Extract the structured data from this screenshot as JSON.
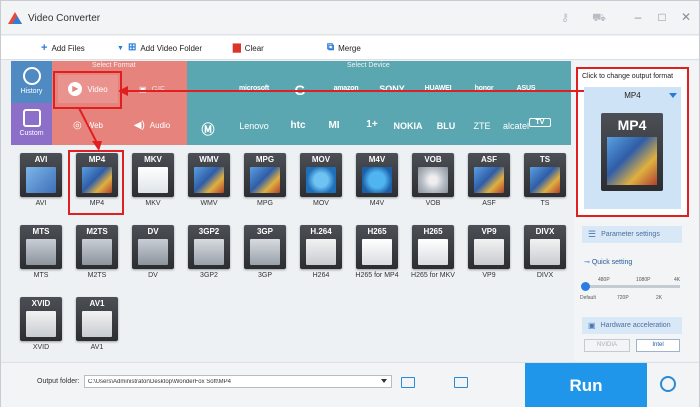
{
  "window": {
    "title": "Video Converter",
    "icons": [
      "key-icon",
      "cart-icon",
      "minimize-icon",
      "maximize-icon",
      "close-icon"
    ]
  },
  "toolbar": {
    "add_files": "Add Files",
    "add_video_folder": "Add Video Folder",
    "clear": "Clear",
    "merge": "Merge"
  },
  "format_panel": {
    "select_format_label": "Select Format",
    "select_device_label": "Select Device",
    "history": "History",
    "custom": "Custom",
    "video": "Video",
    "web": "Web",
    "audio": "Audio",
    "gif_tab": "GIF",
    "device_brands_row1": [
      "apple-icon",
      "microsoft",
      "google",
      "amazon",
      "SONY",
      "HUAWEI",
      "honor",
      "ASUS"
    ],
    "device_brands_row2": [
      "motorola-icon",
      "Lenovo",
      "htc",
      "MI",
      "1+",
      "NOKIA",
      "BLU",
      "ZTE",
      "alcatel",
      "TV"
    ]
  },
  "formats": [
    {
      "tag": "AVI",
      "label": "AVI",
      "art": "reel"
    },
    {
      "tag": "MP4",
      "label": "MP4",
      "art": "film"
    },
    {
      "tag": "MKV",
      "label": "MKV",
      "art": "matroska"
    },
    {
      "tag": "WMV",
      "label": "WMV",
      "art": "film"
    },
    {
      "tag": "MPG",
      "label": "MPG",
      "art": "film"
    },
    {
      "tag": "MOV",
      "label": "MOV",
      "art": "quicktime"
    },
    {
      "tag": "M4V",
      "label": "M4V",
      "art": "itunes"
    },
    {
      "tag": "VOB",
      "label": "VOB",
      "art": "disc"
    },
    {
      "tag": "ASF",
      "label": "ASF",
      "art": "film"
    },
    {
      "tag": "TS",
      "label": "TS",
      "art": "film"
    },
    {
      "tag": "MTS",
      "label": "MTS",
      "art": "camera"
    },
    {
      "tag": "M2TS",
      "label": "M2TS",
      "art": "camera"
    },
    {
      "tag": "DV",
      "label": "DV",
      "art": "camera"
    },
    {
      "tag": "3GP2",
      "label": "3GP2",
      "art": "phone"
    },
    {
      "tag": "3GP",
      "label": "3GP",
      "art": "phone"
    },
    {
      "tag": "H.264",
      "label": "H264",
      "art": "encoder"
    },
    {
      "tag": "H265",
      "label": "H265 for MP4",
      "art": "hevc"
    },
    {
      "tag": "H265",
      "label": "H265 for MKV",
      "art": "hevc"
    },
    {
      "tag": "VP9",
      "label": "VP9",
      "art": "encoder"
    },
    {
      "tag": "DIVX",
      "label": "DIVX",
      "art": "encoder"
    },
    {
      "tag": "XVID",
      "label": "XVID",
      "art": "encoder"
    },
    {
      "tag": "AV1",
      "label": "AV1",
      "art": "encoder"
    }
  ],
  "output": {
    "hint": "Click to change output format",
    "selected": "MP4",
    "parameter_settings": "Parameter settings",
    "quick_setting": "Quick setting",
    "tick_top": [
      "480P",
      "1080P",
      "4K"
    ],
    "tick_bottom": [
      "Default",
      "720P",
      "2K"
    ],
    "quality_position": 0.0,
    "hardware_acceleration": "Hardware acceleration",
    "nvidia": "NVIDIA",
    "intel": "Intel"
  },
  "bottom": {
    "output_folder_label": "Output folder:",
    "output_folder_path": "C:\\Users\\Administrator\\Desktop\\WonderFox Soft\\MP4",
    "run": "Run"
  },
  "colors": {
    "accent": "#1f96ea",
    "format_tab": "#e7837d",
    "device_tab": "#5aa7b1",
    "annotation": "#e02020"
  }
}
